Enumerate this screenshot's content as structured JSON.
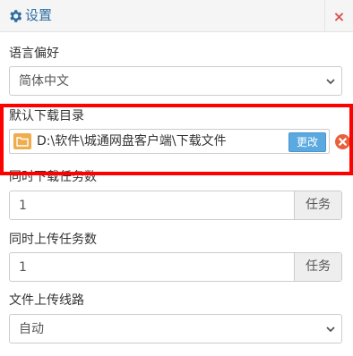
{
  "header": {
    "title": "设置",
    "close": "×"
  },
  "language": {
    "label": "语言偏好",
    "value": "简体中文"
  },
  "download_dir": {
    "label": "默认下载目录",
    "path": "D:\\软件\\城通网盘客户端\\下载文件",
    "change_button": "更改"
  },
  "download_tasks": {
    "label": "同时下载任务数",
    "value": "1",
    "addon": "任务"
  },
  "upload_tasks": {
    "label": "同时上传任务数",
    "value": "1",
    "addon": "任务"
  },
  "upload_line": {
    "label": "文件上传线路",
    "value": "自动"
  },
  "colors": {
    "accent": "#2e6da4",
    "highlight": "#ff0000",
    "close": "#d9534f",
    "button": "#5aa9e0"
  }
}
